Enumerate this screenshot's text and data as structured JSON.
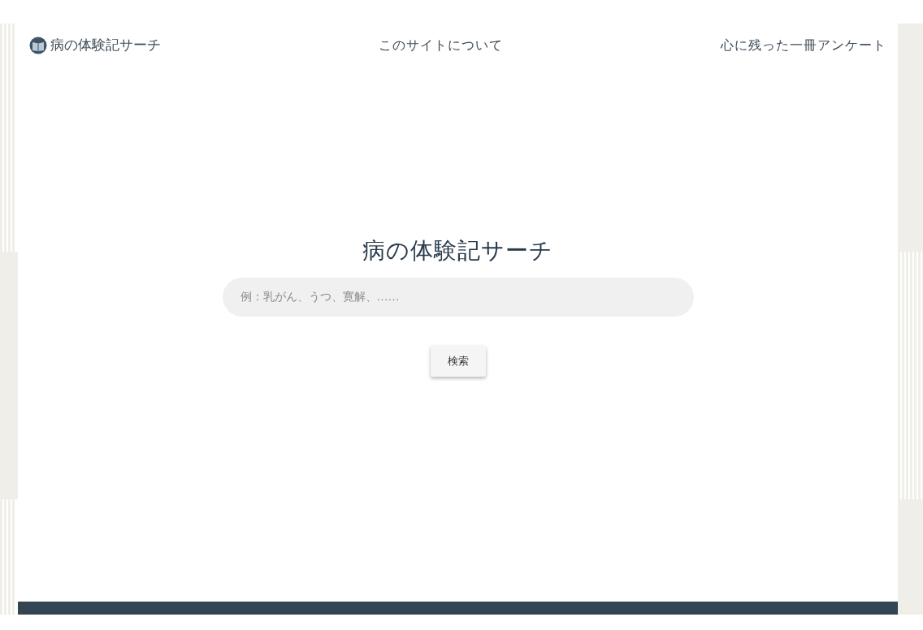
{
  "header": {
    "logo": "病の体験記サーチ",
    "nav": [
      "このサイトについて",
      "心に残った一冊アンケート"
    ]
  },
  "hero": {
    "title": "病の体験記サーチ",
    "search": {
      "placeholder": "例：乳がん、うつ、寛解、……"
    },
    "button": "検索"
  }
}
